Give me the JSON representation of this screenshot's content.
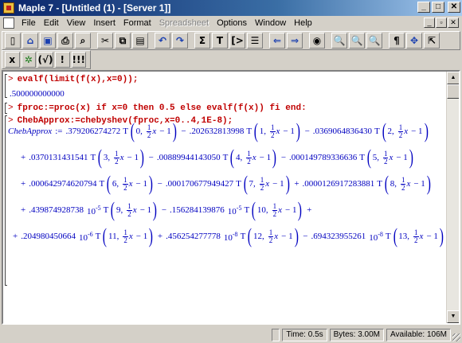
{
  "window": {
    "title": "Maple 7 - [Untitled (1) - [Server 1]]"
  },
  "menu": [
    "File",
    "Edit",
    "View",
    "Insert",
    "Format",
    "Spreadsheet",
    "Options",
    "Window",
    "Help"
  ],
  "menu_disabled": "Spreadsheet",
  "toolbar1": {
    "sigma_label": "Σ",
    "text_label": "T",
    "pilcrow_label": "¶"
  },
  "toolbar2": {
    "x_label": "x",
    "fx_label": "(√)",
    "exclaim_label": "!",
    "triple_exclaim_label": "!!!"
  },
  "worksheet": {
    "input1": "evalf(limit(f(x),x=0));",
    "output1": ".500000000000",
    "input2": "fproc:=proc(x) if x=0 then 0.5 else evalf(f(x)) fi end:",
    "input3": "ChebApprox:=chebyshev(fproc,x=0..4,1E-8);",
    "prompt": ">",
    "lhs": "ChebApprox",
    "assign": ":=",
    "x_symbol": "x",
    "T_symbol": "T",
    "frac_num": "1",
    "frac_den": "2",
    "minus_one": "− 1",
    "ten": "10",
    "terms": [
      {
        "coef": ".379206274272",
        "k": "0",
        "sign_after": "−"
      },
      {
        "coef": ".202632813998",
        "k": "1",
        "sign_after": "−"
      },
      {
        "coef": ".0369064836430",
        "k": "2",
        "sign_after": ""
      },
      {
        "coef": ".0370131431541",
        "k": "3",
        "sign_after": "−"
      },
      {
        "coef": ".00889944143050",
        "k": "4",
        "sign_after": "−"
      },
      {
        "coef": ".000149789336636",
        "k": "5",
        "sign_after": ""
      },
      {
        "coef": ".000642974620794",
        "k": "6",
        "sign_after": "−"
      },
      {
        "coef": ".000170677949427",
        "k": "7",
        "sign_after": "+"
      },
      {
        "coef": ".0000126917283881",
        "k": "8",
        "sign_after": ""
      },
      {
        "coef": ".439874928738",
        "exp": "-5",
        "k": "9",
        "sign_after": "−"
      },
      {
        "coef": ".156284139876",
        "exp": "-5",
        "k": "10",
        "sign_after": "+"
      },
      {
        "coef": ".204980450664",
        "exp": "-6",
        "k": "11",
        "sign_after": "+"
      },
      {
        "coef": ".456254277778",
        "exp": "-8",
        "k": "12",
        "sign_after": "−"
      },
      {
        "coef": ".694323955261",
        "exp": "-8",
        "k": "13",
        "sign_after": ""
      }
    ]
  },
  "status": {
    "time_label": "Time:",
    "time": "0.5s",
    "bytes_label": "Bytes:",
    "bytes": "3.00M",
    "avail_label": "Available:",
    "available": "106M"
  }
}
